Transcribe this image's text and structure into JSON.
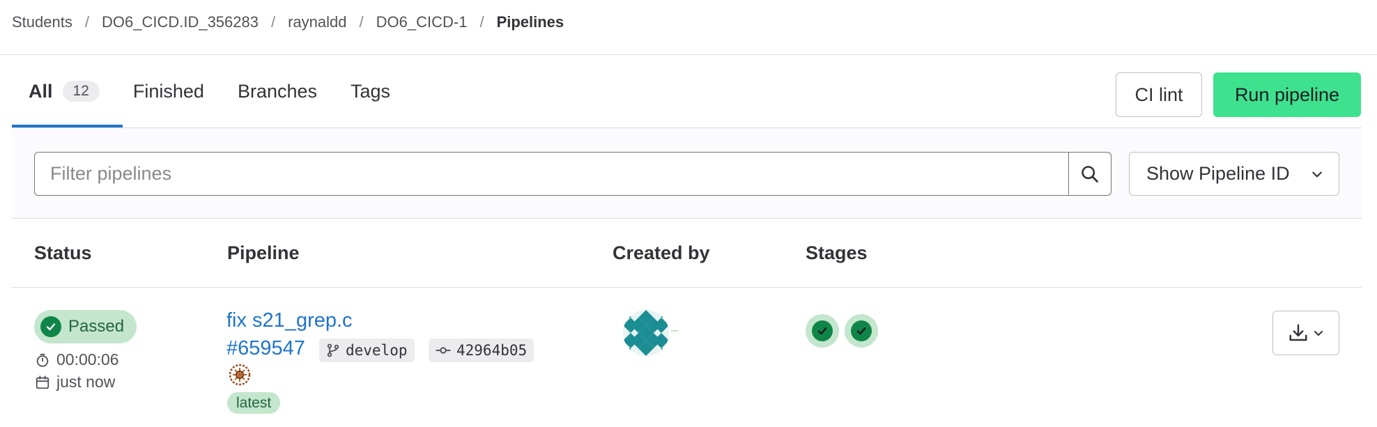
{
  "breadcrumb": [
    {
      "label": "Students"
    },
    {
      "label": "DO6_CICD.ID_356283"
    },
    {
      "label": "raynaldd"
    },
    {
      "label": "DO6_CICD-1"
    },
    {
      "label": "Pipelines"
    }
  ],
  "tabs": [
    {
      "label": "All",
      "count": "12",
      "active": true
    },
    {
      "label": "Finished"
    },
    {
      "label": "Branches"
    },
    {
      "label": "Tags"
    }
  ],
  "actions": {
    "ci_lint_label": "CI lint",
    "run_pipeline_label": "Run pipeline"
  },
  "filter": {
    "placeholder": "Filter pipelines",
    "show_id_label": "Show Pipeline ID"
  },
  "table": {
    "headers": [
      "Status",
      "Pipeline",
      "Created by",
      "Stages"
    ],
    "rows": [
      {
        "status": "Passed",
        "duration": "00:00:06",
        "finished": "just now",
        "commit_title": "fix s21_grep.c",
        "pipeline_id": "#659547",
        "branch": "develop",
        "commit_sha": "42964b05",
        "badge": "latest",
        "stages": [
          "success",
          "success"
        ]
      }
    ]
  },
  "colors": {
    "link": "#1f75cb",
    "success": "#108548",
    "success_bg": "#c3e6cd",
    "run_button": "#3ee28e",
    "tab_underline": "#1f75cb"
  }
}
